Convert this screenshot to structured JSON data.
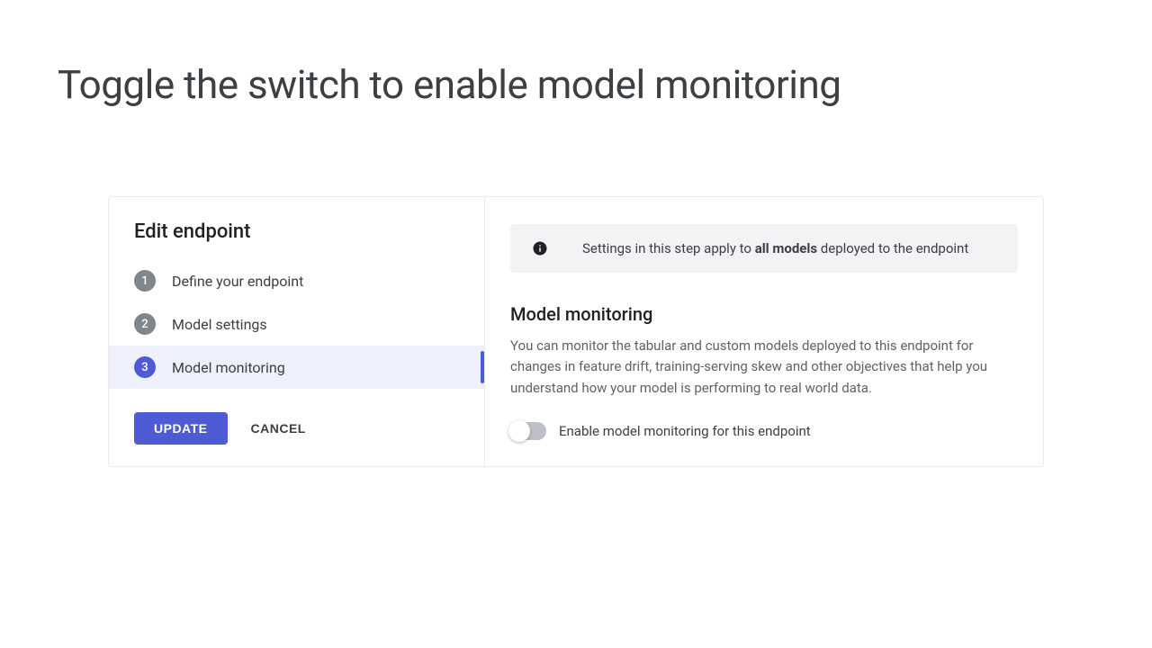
{
  "page": {
    "title": "Toggle the switch to enable model monitoring"
  },
  "sidebar": {
    "title": "Edit endpoint",
    "steps": [
      {
        "num": "1",
        "label": "Define your endpoint"
      },
      {
        "num": "2",
        "label": "Model settings"
      },
      {
        "num": "3",
        "label": "Model monitoring"
      }
    ],
    "update_label": "UPDATE",
    "cancel_label": "CANCEL"
  },
  "content": {
    "info_prefix": "Settings in this step apply to ",
    "info_bold": "all models",
    "info_suffix": " deployed to the endpoint",
    "section_title": "Model monitoring",
    "section_desc": "You can monitor the tabular and custom models deployed to this endpoint for changes in feature drift, training-serving skew and other objectives that help you understand how your model is performing to real world data.",
    "toggle_label": "Enable model monitoring for this endpoint",
    "toggle_state": false
  }
}
